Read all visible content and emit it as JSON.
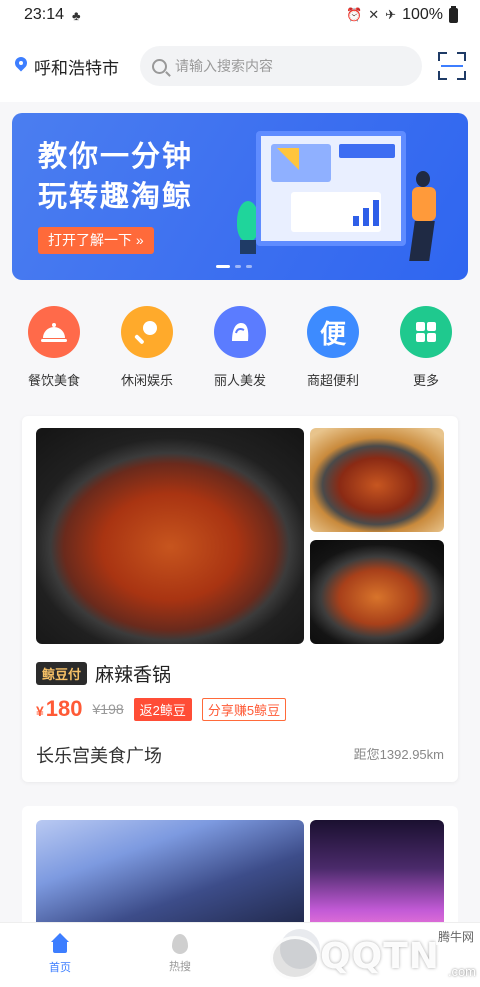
{
  "status_bar": {
    "time": "23:14",
    "battery": "100%"
  },
  "header": {
    "city": "呼和浩特市",
    "search_placeholder": "请输入搜索内容"
  },
  "banner": {
    "title_line1": "教你一分钟",
    "title_line2": "玩转趣淘鲸",
    "button": "打开了解一下 »",
    "slide_count": 3,
    "active_slide": 1
  },
  "categories": [
    {
      "label": "餐饮美食",
      "icon": "cloche-icon",
      "color": "#ff6a4a"
    },
    {
      "label": "休闲娱乐",
      "icon": "microphone-icon",
      "color": "#ffaa2b"
    },
    {
      "label": "丽人美发",
      "icon": "hair-icon",
      "color": "#5b7cff"
    },
    {
      "label": "商超便利",
      "icon": "store-icon",
      "glyph": "便",
      "color": "#3d8bff"
    },
    {
      "label": "更多",
      "icon": "grid-icon",
      "color": "#1fc98e"
    }
  ],
  "deal": {
    "pay_badge": "鲸豆付",
    "title": "麻辣香锅",
    "price_symbol": "¥",
    "price": "180",
    "original_price": "¥198",
    "tag_rebate": "返2鲸豆",
    "tag_share": "分享赚5鲸豆",
    "shop": "长乐宫美食广场",
    "distance": "距您1392.95km"
  },
  "tabbar": {
    "tabs": [
      {
        "label": "首页",
        "icon": "home-icon",
        "active": true
      },
      {
        "label": "热搜",
        "icon": "fire-icon",
        "active": false
      },
      {
        "label": "",
        "icon": "center-icon",
        "active": false
      },
      {
        "label": "",
        "icon": "mine-icon",
        "active": false
      }
    ]
  },
  "watermark": {
    "site": "腾牛网",
    "brand": "QQTN",
    "suffix": ".com"
  }
}
